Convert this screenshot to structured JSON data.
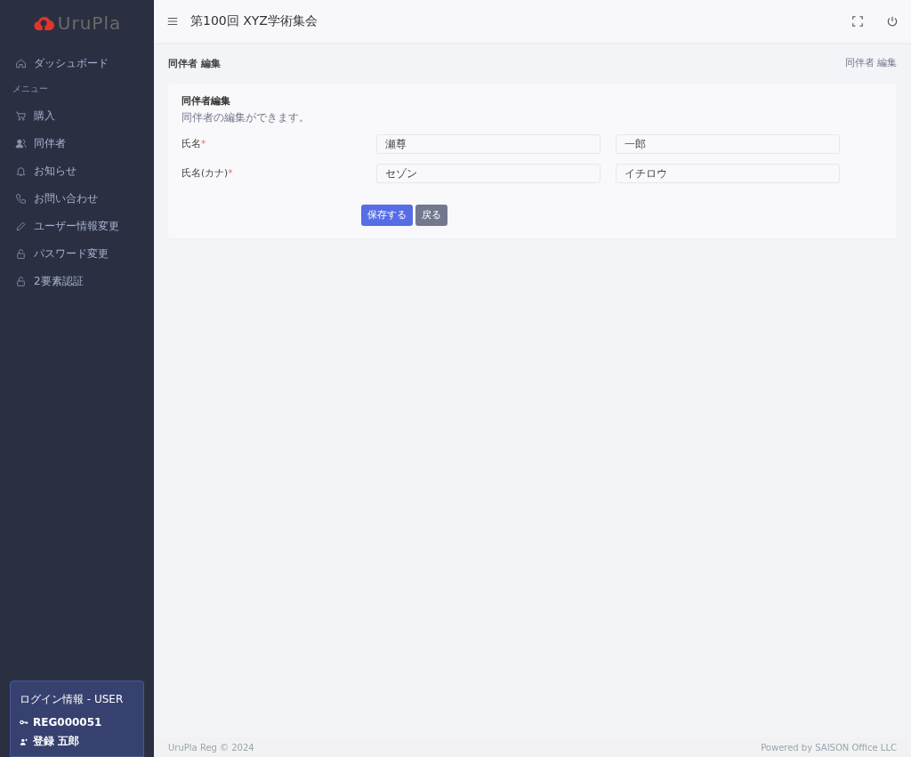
{
  "sidebar": {
    "logo": "UruPla",
    "items": [
      {
        "kind": "link",
        "label": "ダッシュボード",
        "selected": false
      },
      {
        "kind": "heading",
        "label": "メニュー"
      },
      {
        "kind": "link",
        "label": "購入",
        "selected": false
      },
      {
        "kind": "link",
        "label": "同伴者",
        "selected": false
      },
      {
        "kind": "link",
        "label": "お知らせ",
        "selected": false
      },
      {
        "kind": "link",
        "label": "お問い合わせ",
        "selected": false
      },
      {
        "kind": "link",
        "label": "ユーザー情報変更",
        "selected": false
      },
      {
        "kind": "link",
        "label": "パスワード変更",
        "selected": false
      },
      {
        "kind": "link",
        "label": "2要素認証",
        "selected": false
      }
    ],
    "login": {
      "title": "ログイン情報 - USER",
      "id": "REG000051",
      "name": "登録 五郎"
    }
  },
  "header": {
    "title": "第100回 XYZ学術集会"
  },
  "page": {
    "title": "同伴者 編集",
    "breadcrumb": "同伴者 編集"
  },
  "card": {
    "title": "同伴者編集",
    "subtitle": "同伴者の編集ができます。",
    "fields": [
      {
        "label": "氏名",
        "required_mark": "*",
        "values": [
          "瀬尊",
          "一郎"
        ]
      },
      {
        "label": "氏名(カナ)",
        "required_mark": "*",
        "values": [
          "セゾン",
          "イチロウ"
        ]
      }
    ],
    "buttons": [
      {
        "kind": "primary",
        "label": "保存する"
      },
      {
        "kind": "secondary",
        "label": "戻る"
      }
    ]
  },
  "footer": {
    "left": "UruPla Reg © 2024",
    "right": "Powered by SAISON Office LLC"
  }
}
